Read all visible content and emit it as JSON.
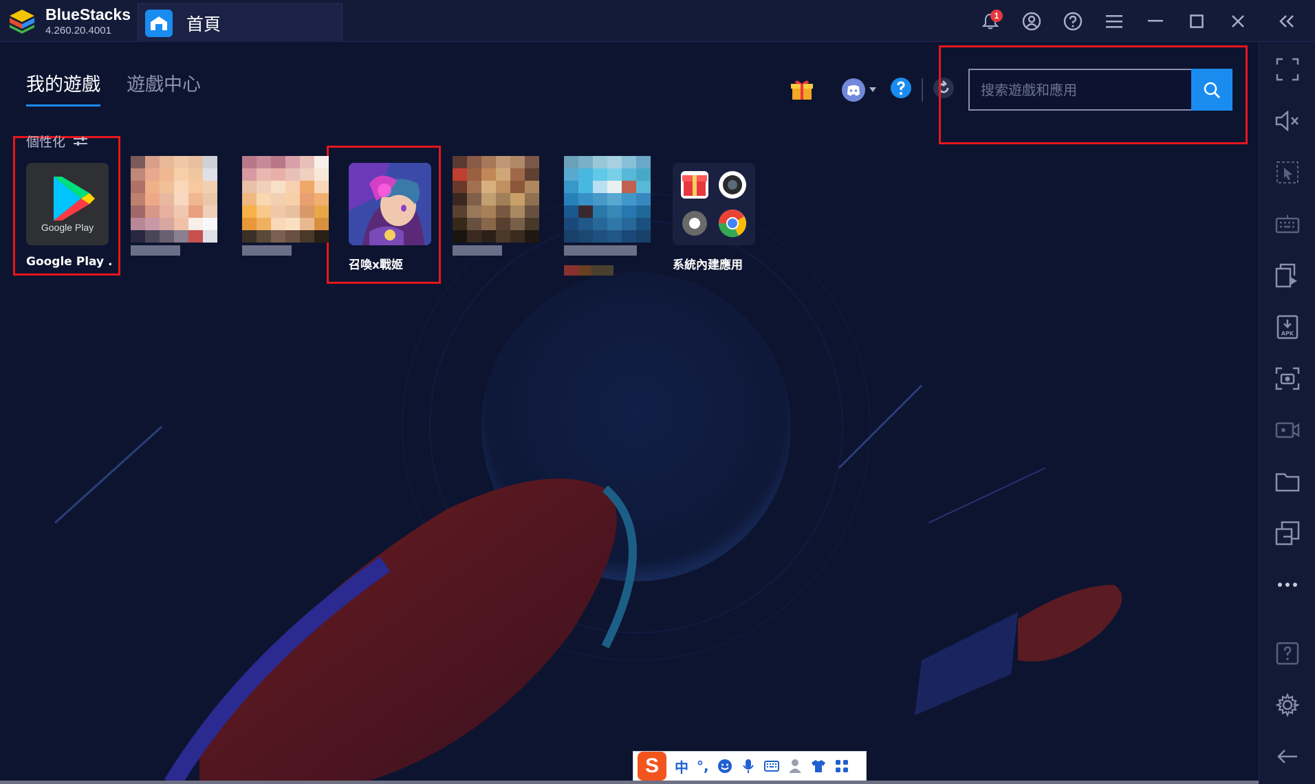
{
  "app": {
    "name": "BlueStacks",
    "version": "4.260.20.4001"
  },
  "tab": {
    "home_label": "首頁"
  },
  "titlebar": {
    "notification_count": "1"
  },
  "nav": {
    "tabs": [
      {
        "label": "我的遊戲",
        "active": true
      },
      {
        "label": "遊戲中心",
        "active": false
      }
    ]
  },
  "search": {
    "placeholder": "搜索遊戲和應用",
    "value": ""
  },
  "section": {
    "label": "個性化"
  },
  "apps": [
    {
      "name": "Google Play ...",
      "icon": "google-play-icon",
      "icon_text": "Google Play"
    },
    {
      "name": "",
      "icon": "pixelated-app-icon"
    },
    {
      "name": "",
      "icon": "pixelated-app-icon"
    },
    {
      "name": "召喚x戰姬",
      "icon": "game-character-icon"
    },
    {
      "name": "",
      "icon": "pixelated-app-icon"
    },
    {
      "name": "",
      "icon": "pixelated-app-icon"
    },
    {
      "name": "系統內建應用",
      "icon": "system-apps-folder-icon"
    }
  ],
  "ime": {
    "logo": "S",
    "mode": "中",
    "punct": "°,"
  },
  "colors": {
    "accent": "#1a8cf0",
    "highlight": "#e8161b",
    "background": "#0d1430",
    "badge": "#e8383d"
  }
}
